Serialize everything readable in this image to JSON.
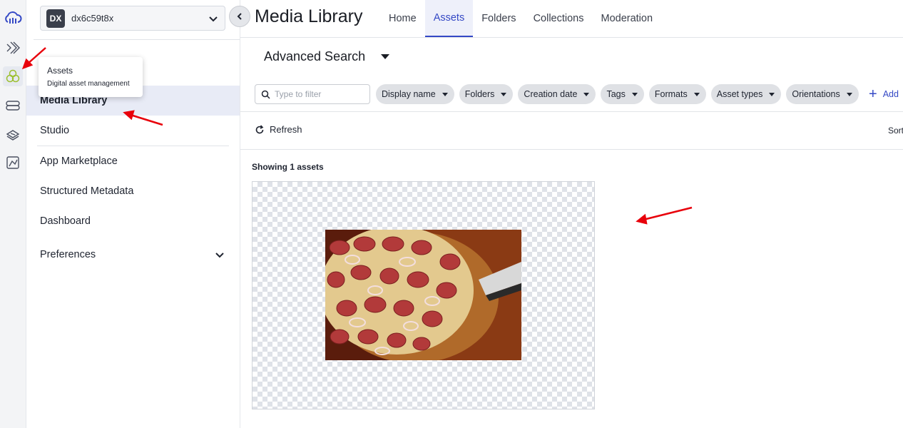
{
  "rail": {
    "items": [
      {
        "icon": "cloudinary-logo-icon"
      },
      {
        "icon": "developer-icon"
      },
      {
        "icon": "assets-icon"
      },
      {
        "icon": "video-icon"
      },
      {
        "icon": "integrations-icon"
      },
      {
        "icon": "usage-icon"
      }
    ]
  },
  "sidebar": {
    "environment": {
      "badge": "DX",
      "name": "dx6c59t8x"
    },
    "items": [
      {
        "label": "Media Library",
        "selected": true
      },
      {
        "label": "Studio"
      },
      {
        "label": "App Marketplace"
      },
      {
        "label": "Structured Metadata"
      },
      {
        "label": "Dashboard"
      },
      {
        "label": "Preferences",
        "expandable": true
      }
    ]
  },
  "tooltip": {
    "title": "Assets",
    "subtitle": "Digital asset management"
  },
  "header": {
    "title": "Media Library",
    "tabs": [
      {
        "label": "Home"
      },
      {
        "label": "Assets",
        "active": true
      },
      {
        "label": "Folders"
      },
      {
        "label": "Collections"
      },
      {
        "label": "Moderation"
      }
    ]
  },
  "search": {
    "title": "Advanced Search",
    "placeholder": "Type to filter",
    "filters": [
      "Display name",
      "Folders",
      "Creation date",
      "Tags",
      "Formats",
      "Asset types",
      "Orientations"
    ],
    "add_label": "Add"
  },
  "toolbar": {
    "refresh_label": "Refresh",
    "sort_label": "Sort"
  },
  "results": {
    "count_label": "Showing 1 assets"
  },
  "colors": {
    "accent": "#3448c5",
    "annotation": "#e8000b"
  }
}
